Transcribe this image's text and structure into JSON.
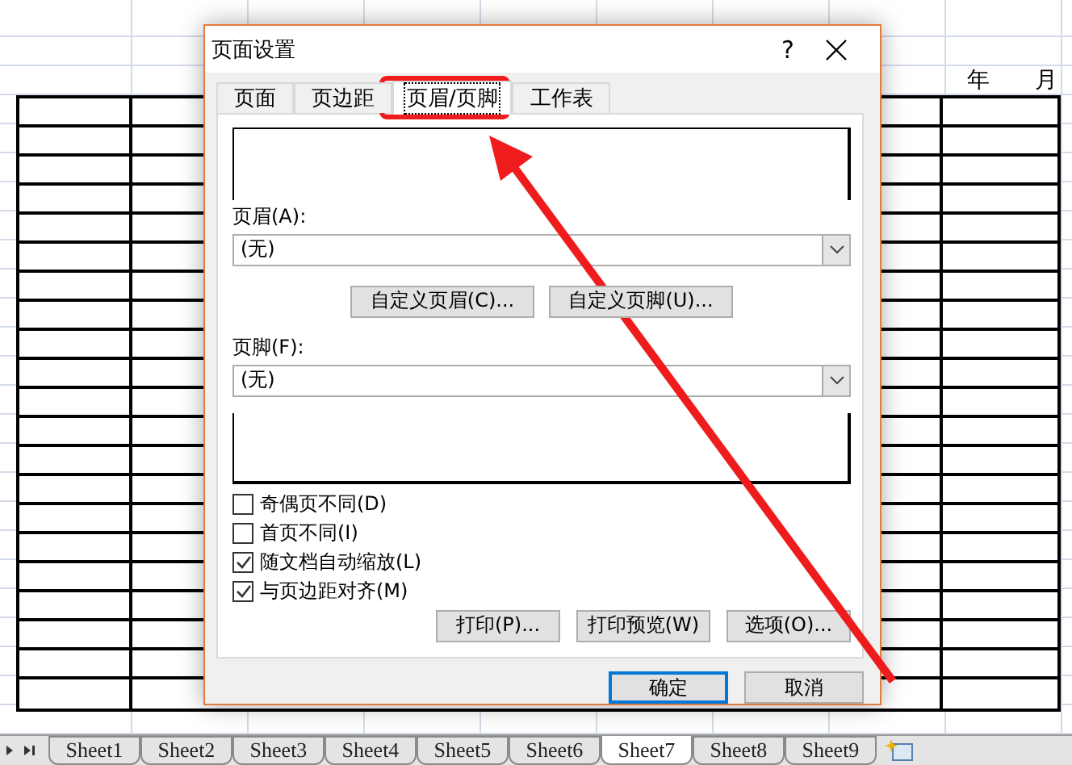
{
  "sheet": {
    "year_label": "年",
    "month_label": "月"
  },
  "sheet_tabs": [
    {
      "label": "Sheet1",
      "selected": false
    },
    {
      "label": "Sheet2",
      "selected": false
    },
    {
      "label": "Sheet3",
      "selected": false
    },
    {
      "label": "Sheet4",
      "selected": false
    },
    {
      "label": "Sheet5",
      "selected": false
    },
    {
      "label": "Sheet6",
      "selected": false
    },
    {
      "label": "Sheet7",
      "selected": true
    },
    {
      "label": "Sheet8",
      "selected": false
    },
    {
      "label": "Sheet9",
      "selected": false
    }
  ],
  "dialog": {
    "title": "页面设置",
    "help": "?",
    "tabs": [
      {
        "label": "页面",
        "selected": false
      },
      {
        "label": "页边距",
        "selected": false
      },
      {
        "label": "页眉/页脚",
        "selected": true
      },
      {
        "label": "工作表",
        "selected": false
      }
    ],
    "header_label": "页眉(A):",
    "header_value": "(无)",
    "custom_buttons": [
      "自定义页眉(C)...",
      "自定义页脚(U)..."
    ],
    "footer_label": "页脚(F):",
    "footer_value": "(无)",
    "checkboxes": [
      {
        "label": "奇偶页不同(D)",
        "checked": false
      },
      {
        "label": "首页不同(I)",
        "checked": false
      },
      {
        "label": "随文档自动缩放(L)",
        "checked": true
      },
      {
        "label": "与页边距对齐(M)",
        "checked": true
      }
    ],
    "action_buttons": [
      "打印(P)...",
      "打印预览(W)",
      "选项(O)..."
    ],
    "ok": "确定",
    "cancel": "取消"
  }
}
